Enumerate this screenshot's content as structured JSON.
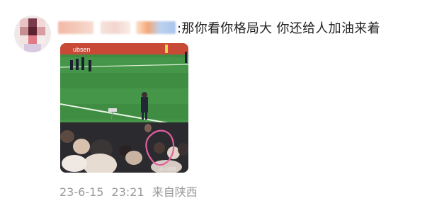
{
  "comment": {
    "text": ":那你看你格局大 你还给人加油来着"
  },
  "meta": {
    "date": "23-6-15",
    "time": "23:21",
    "location": "来自陕西"
  },
  "photo": {
    "board_text": "ubsen",
    "watermark": "@小周呀"
  },
  "colors": {
    "text": "#222222",
    "meta": "#9a9a9a",
    "pitch": "#3d8a42",
    "highlight_circle": "#e25fa0"
  }
}
